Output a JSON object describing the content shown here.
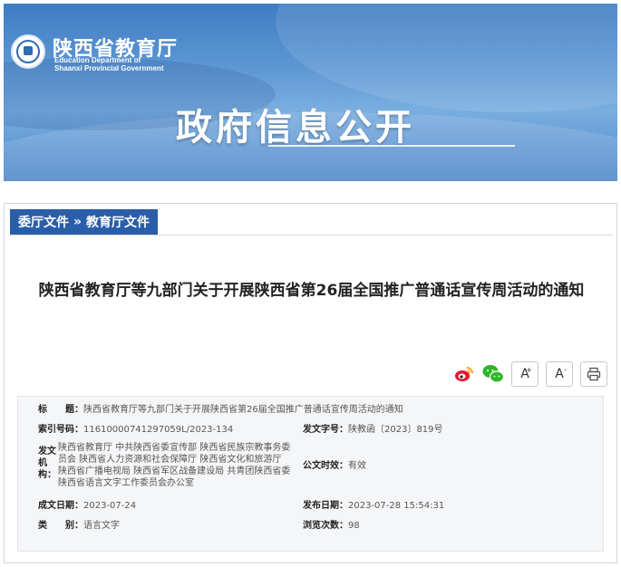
{
  "header": {
    "org_cn": "陕西省教育厅",
    "org_en_line1": "Education Department of",
    "org_en_line2": "Shaanxi Provincial Government",
    "banner_title": "政府信息公开",
    "logo_icon": "emblem-icon",
    "colors": {
      "banner": "#4d86c8",
      "accent": "#2a5ea8"
    }
  },
  "breadcrumb": {
    "item1": "委厅文件",
    "separator": "»",
    "item2": "教育厅文件"
  },
  "document": {
    "title": "陕西省教育厅等九部门关于开展陕西省第26届全国推广普通话宣传周活动的通知"
  },
  "tools": {
    "weibo_icon": "weibo-icon",
    "wechat_icon": "wechat-icon",
    "font_increase": "A",
    "font_increase_sup": "+",
    "font_decrease": "A",
    "font_decrease_sup": "-",
    "print_icon": "print-icon"
  },
  "meta": {
    "title_label": "标　　题：",
    "title_value": "陕西省教育厅等九部门关于开展陕西省第26届全国推广普通话宣传周活动的通知",
    "index_label": "索引号码：",
    "index_value": "11610000741297059L/2023-134",
    "docno_label": "发文字号：",
    "docno_value": "陕教函〔2023〕819号",
    "issuer_label_1": "发文",
    "issuer_label_2": "机",
    "issuer_label_3": "构：",
    "issuer_value_1": "陕西省教育厅 中共陕西省委宣传部 陕西省民族宗教事务委",
    "issuer_value_2": "员会 陕西省人力资源和社会保障厅 陕西省文化和旅游厅",
    "issuer_value_3": "陕西省广播电视局 陕西省军区战备建设局 共青团陕西省委",
    "issuer_value_4": "陕西省语言文字工作委员会办公室",
    "validity_label": "公文时效：",
    "validity_value": "有效",
    "created_label": "成文日期：",
    "created_value": "2023-07-24",
    "published_label": "发布日期：",
    "published_value": "2023-07-28 15:54:31",
    "category_label": "类　　别：",
    "category_value": "语言文字",
    "views_label": "浏览次数：",
    "views_value": "98"
  }
}
